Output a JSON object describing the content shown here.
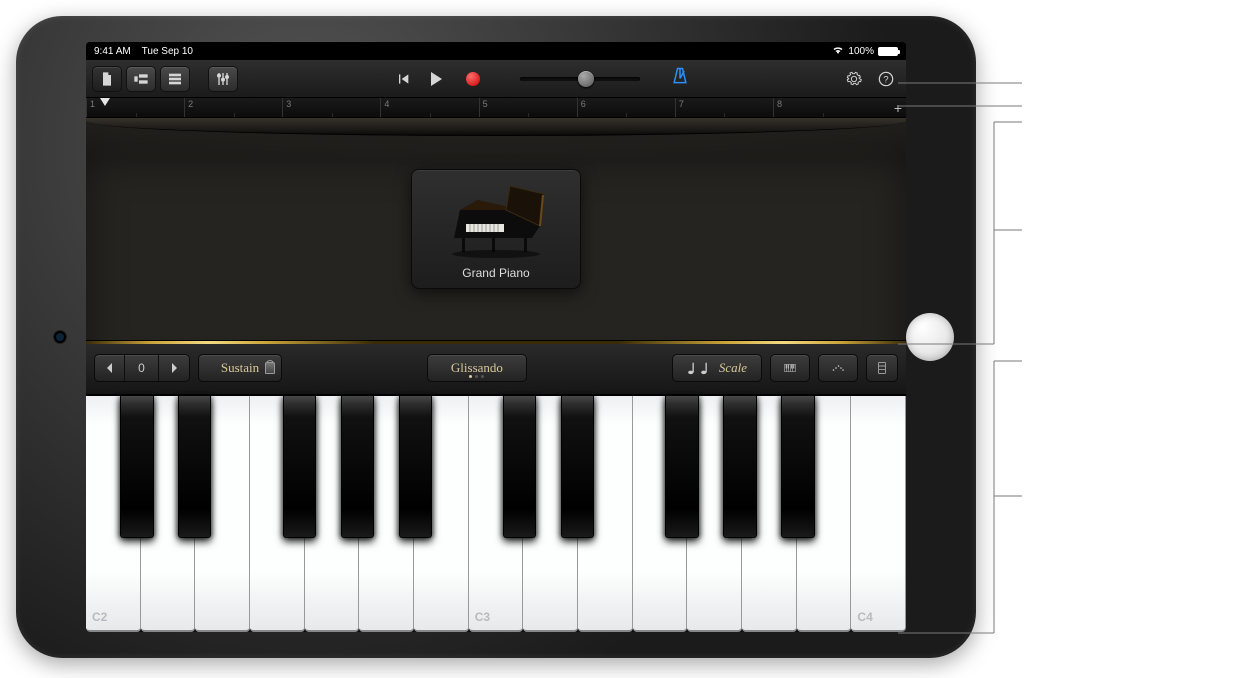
{
  "status_bar": {
    "time": "9:41 AM",
    "date": "Tue Sep 10",
    "battery_pct": "100%"
  },
  "control_bar": {
    "my_songs_icon": "document-icon",
    "browser_icon": "panels-icon",
    "tracks_icon": "rows-icon",
    "mixer_icon": "sliders-icon",
    "skip_back_icon": "skip-back-icon",
    "play_icon": "play-icon",
    "record_icon": "record-icon",
    "volume_thumb_pos": 0.55,
    "metronome_icon": "metronome-icon",
    "settings_icon": "gear-icon",
    "help_icon": "help-icon"
  },
  "ruler": {
    "bars": [
      "1",
      "2",
      "3",
      "4",
      "5",
      "6",
      "7",
      "8"
    ],
    "add_label": "+"
  },
  "instrument": {
    "name": "Grand Piano"
  },
  "key_controls": {
    "octave_value": "0",
    "sustain_label": "Sustain",
    "glissando_label": "Glissando",
    "scale_label": "Scale",
    "keyboard_mode_icon": "keyboard-icon",
    "arpeggiator_icon": "arpeggiator-icon",
    "layout_icon": "keyboard-layout-icon"
  },
  "keyboard": {
    "white_keys": 15,
    "labels": {
      "0": "C2",
      "7": "C3",
      "14": "C4"
    },
    "black_pattern": [
      0,
      1,
      3,
      4,
      5,
      7,
      8,
      10,
      11,
      12
    ]
  }
}
